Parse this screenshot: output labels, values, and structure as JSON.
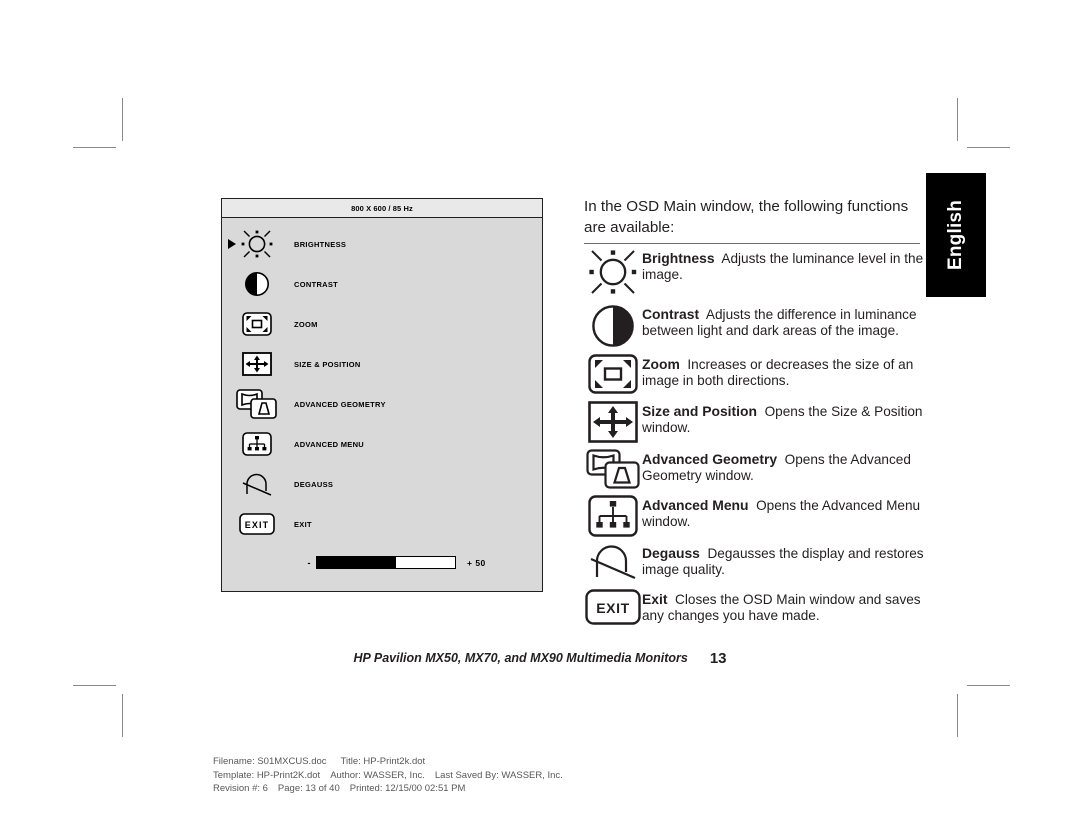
{
  "osd": {
    "title": "800 X 600 / 85 Hz",
    "selected_index": 0,
    "items": [
      {
        "icon": "brightness-icon",
        "label": "BRIGHTNESS"
      },
      {
        "icon": "contrast-icon",
        "label": "CONTRAST"
      },
      {
        "icon": "zoom-icon",
        "label": "ZOOM"
      },
      {
        "icon": "size-position-icon",
        "label": "SIZE & POSITION"
      },
      {
        "icon": "advanced-geometry-icon",
        "label": "ADVANCED GEOMETRY"
      },
      {
        "icon": "advanced-menu-icon",
        "label": "ADVANCED MENU"
      },
      {
        "icon": "degauss-icon",
        "label": "DEGAUSS"
      },
      {
        "icon": "exit-icon",
        "label": "EXIT"
      }
    ],
    "exit_icon_text": "EXIT",
    "slider": {
      "minus_label": "-",
      "plus_label": "+ 50",
      "value": 50,
      "fill_percent": 57
    }
  },
  "intro": {
    "text": "In the OSD Main window, the following functions are available:"
  },
  "definitions": [
    {
      "icon": "brightness-icon",
      "term": "Brightness",
      "desc": "Adjusts the luminance level  in the image."
    },
    {
      "icon": "contrast-icon",
      "term": "Contrast",
      "desc": "Adjusts the difference in luminance between light and dark areas of the image."
    },
    {
      "icon": "zoom-icon",
      "term": "Zoom",
      "desc": "Increases or decreases the size of an image in both directions."
    },
    {
      "icon": "size-position-icon",
      "term": "Size and Position",
      "desc": "Opens the Size & Position window."
    },
    {
      "icon": "advanced-geometry-icon",
      "term": "Advanced Geometry",
      "desc": "Opens the Advanced Geometry window."
    },
    {
      "icon": "advanced-menu-icon",
      "term": "Advanced Menu",
      "desc": "Opens the Advanced Menu window."
    },
    {
      "icon": "degauss-icon",
      "term": "Degauss",
      "desc": "Degausses the display and restores image quality."
    },
    {
      "icon": "exit-icon",
      "term": "Exit",
      "desc": "Closes the OSD Main window and saves any changes you have made.",
      "icon_text": "EXIT"
    }
  ],
  "language_tab": {
    "label": "English"
  },
  "running_footer": {
    "title": "HP Pavilion MX50, MX70, and MX90 Multimedia Monitors",
    "page_number": "13"
  },
  "doc_info": {
    "line1_a": "Filename: S01MXCUS.doc",
    "line1_b": "Title: HP-Print2k.dot",
    "line2_a": "Template: HP-Print2K.dot",
    "line2_b": "Author: WASSER, Inc.",
    "line2_c": "Last Saved By: WASSER, Inc.",
    "line3_a": "Revision #: 6",
    "line3_b": "Page: 13 of 40",
    "line3_c": "Printed: 12/15/00 02:51 PM"
  },
  "colors": {
    "ink": "#231f20",
    "osd_body": "#d9d9d9",
    "osd_title": "#e9e9e9",
    "tab_bg": "#000000",
    "crop_mark": "#8a8a8a",
    "doc_info": "#58585b"
  }
}
